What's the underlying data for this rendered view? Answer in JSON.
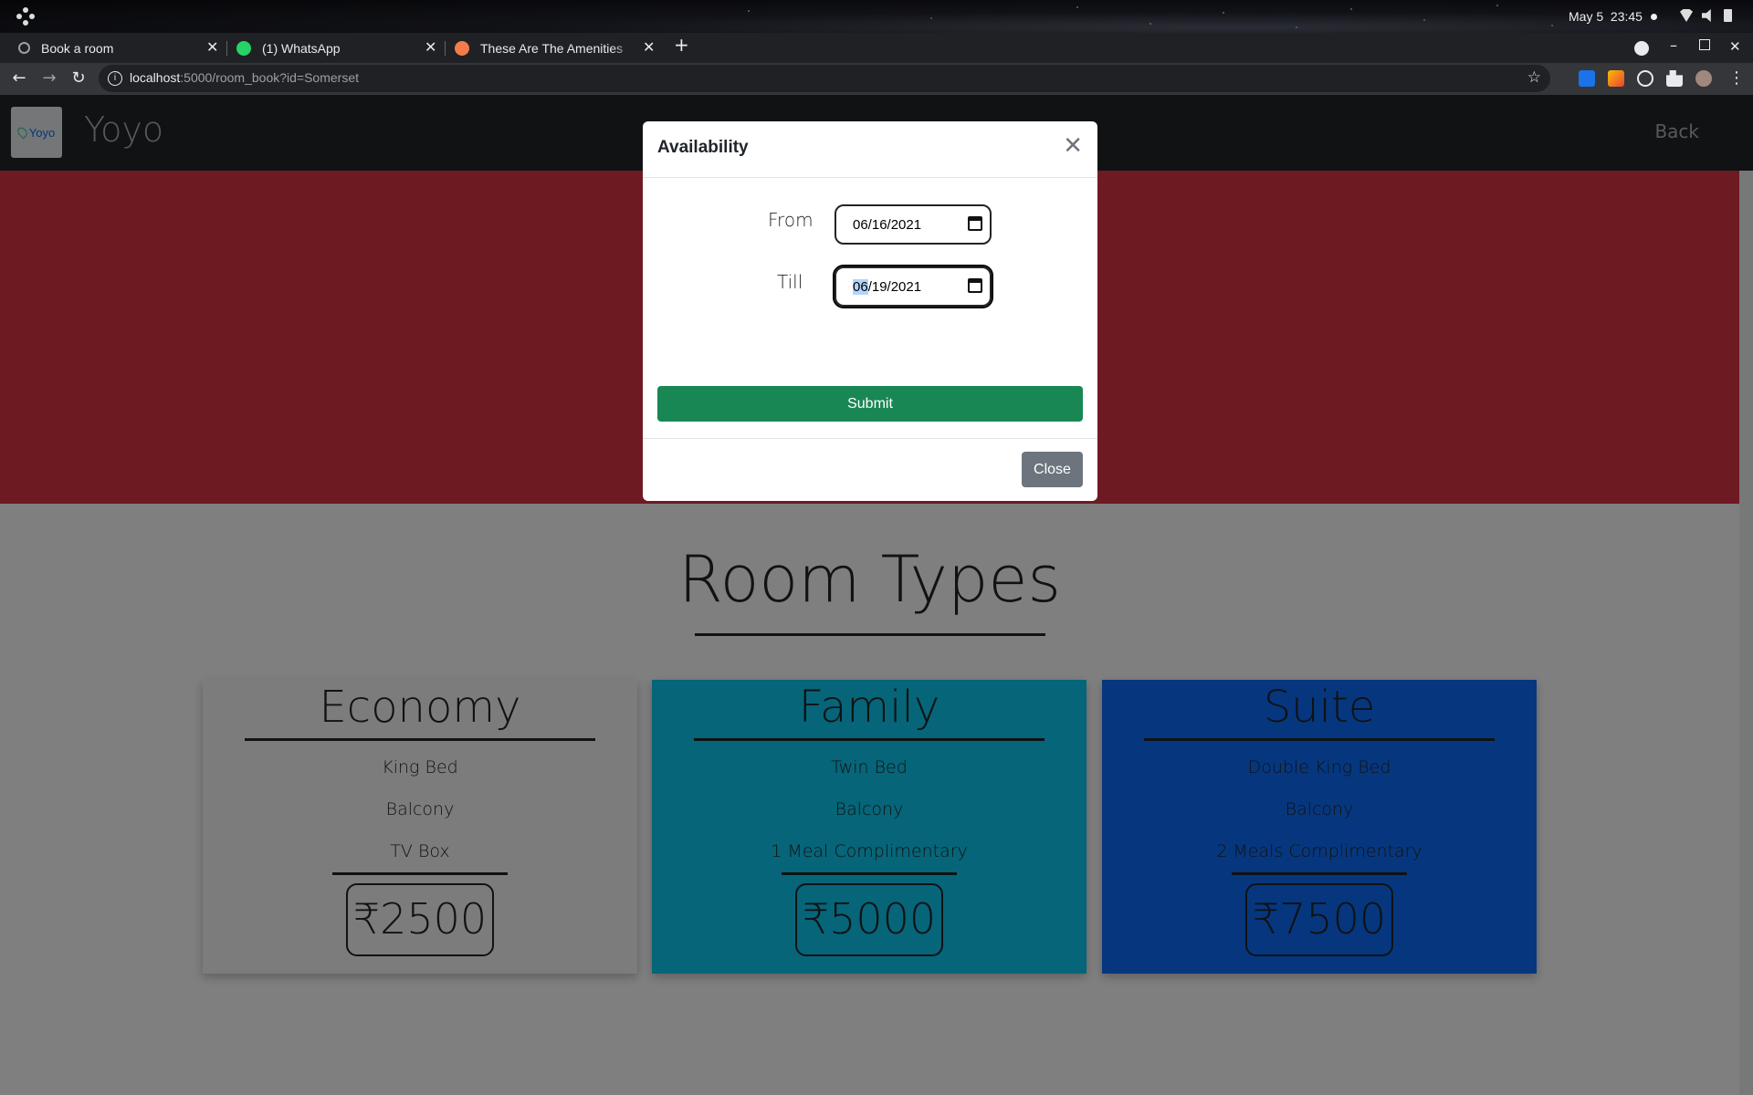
{
  "os": {
    "date": "May 5",
    "time": "23:45"
  },
  "browser": {
    "tabs": [
      {
        "title": "Book a room",
        "icon": "globe-icon"
      },
      {
        "title": "(1) WhatsApp",
        "icon": "whatsapp-icon"
      },
      {
        "title": "These Are The Amenities",
        "icon": "blog-icon"
      }
    ],
    "url_host": "localhost",
    "url_path": ":5000/room_book?id=Somerset"
  },
  "site": {
    "brand_logo_text": "Yoyo",
    "brand_name": "Yoyo",
    "back_label": "Back",
    "hero_color": "#dc3545"
  },
  "room_types": {
    "title": "Room Types",
    "cards": [
      {
        "name": "Economy",
        "features": [
          "King Bed",
          "Balcony",
          "TV Box"
        ],
        "price": "₹2500",
        "color": "#f8f9fa"
      },
      {
        "name": "Family",
        "features": [
          "Twin Bed",
          "Balcony",
          "1 Meal Complimentary"
        ],
        "price": "₹5000",
        "color": "#0dcaf0"
      },
      {
        "name": "Suite",
        "features": [
          "Double King Bed",
          "Balcony",
          "2 Meals Complimentary"
        ],
        "price": "₹7500",
        "color": "#0d6efd"
      }
    ]
  },
  "modal": {
    "title": "Availability",
    "from_label": "From",
    "from_value": "06/16/2021",
    "till_label": "Till",
    "till_month": "06",
    "till_rest": "/19/2021",
    "submit_label": "Submit",
    "close_label": "Close"
  }
}
